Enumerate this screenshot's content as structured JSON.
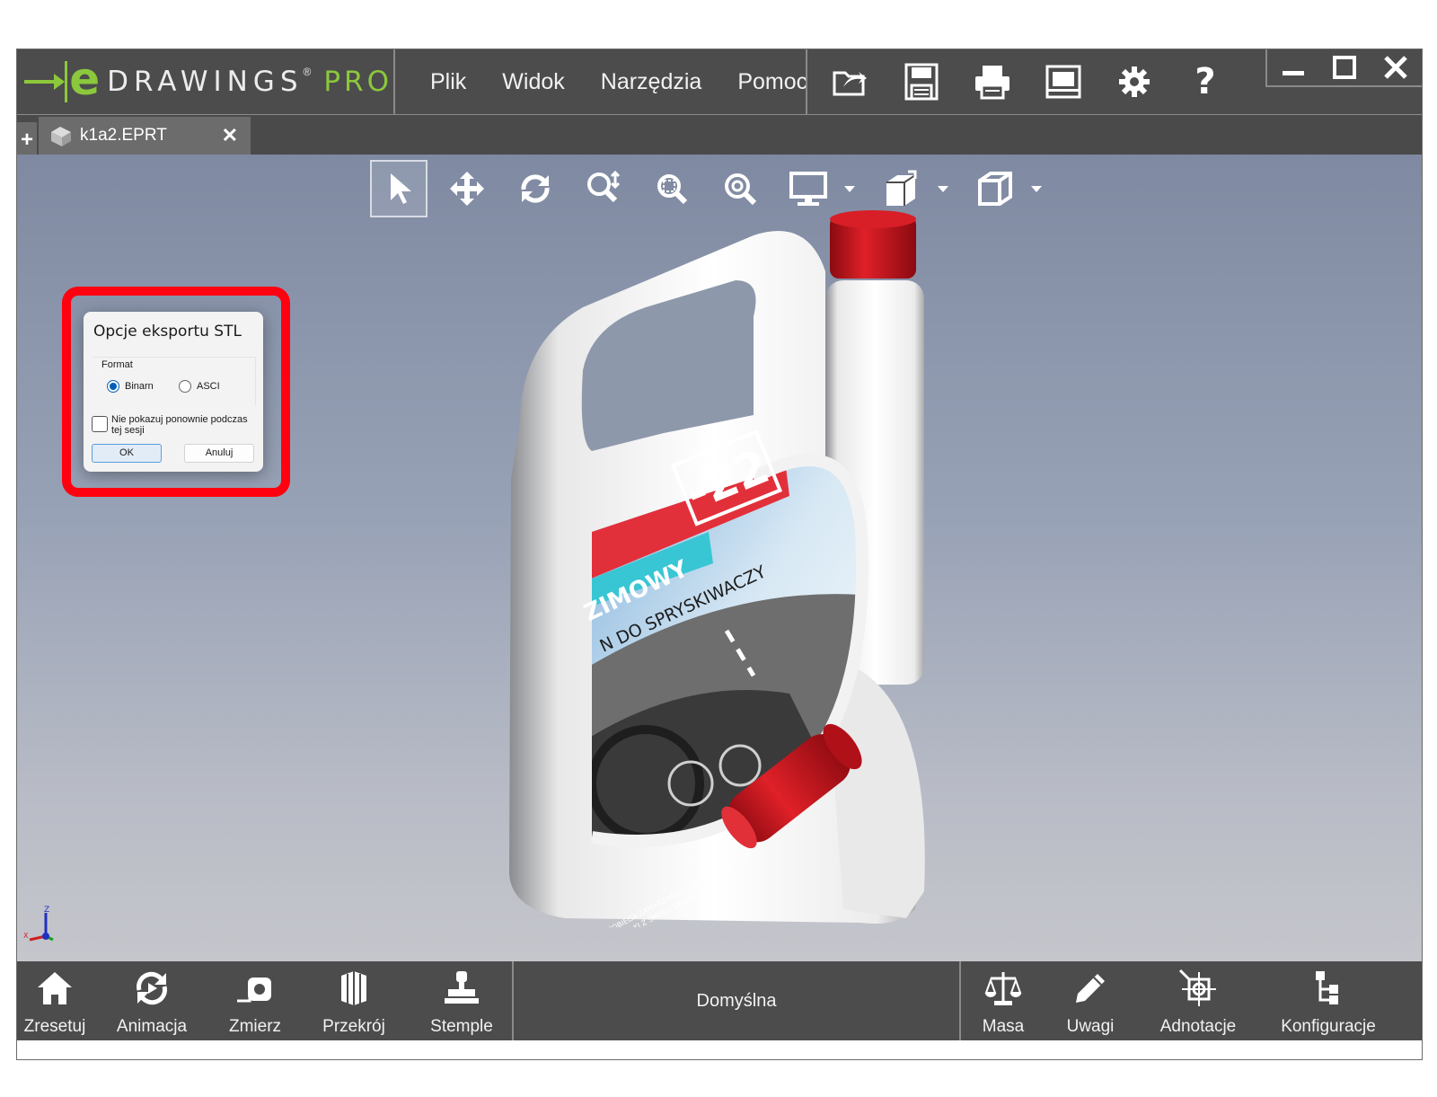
{
  "app": {
    "logo_e": "e",
    "logo_brand": "DRAWINGS",
    "logo_reg": "®",
    "logo_pro": "PRO"
  },
  "menu": [
    {
      "label": "Plik"
    },
    {
      "label": "Widok"
    },
    {
      "label": "Narzędzia"
    },
    {
      "label": "Pomoc"
    }
  ],
  "toolbar_icons": [
    "open-icon",
    "save-icon",
    "print-icon",
    "publish-icon",
    "settings-gear-icon",
    "help-icon"
  ],
  "window_controls": [
    "minimize-icon",
    "maximize-icon",
    "close-icon"
  ],
  "tabs": {
    "new_tab_label": "+",
    "active": {
      "label": "k1a2.EPRT",
      "close_label": "✕"
    }
  },
  "view_toolbar": [
    "select-arrow-icon",
    "pan-icon",
    "rotate-icon",
    "zoom-icon",
    "zoom-to-area-icon",
    "zoom-to-fit-icon",
    "display-style-icon",
    "views-icon",
    "view-orientation-icon"
  ],
  "model_label": {
    "temp": "-22",
    "line1": "ZIMOWY",
    "line2": "N DO SPRYSKIWACZY",
    "small1": "ZAPOBIEGA ZAMARZANIU DYSZ SPRYSKIWACZY",
    "small2": "USZCZELKI Z SMUG I ZACIEKÓW"
  },
  "dialog": {
    "title": "Opcje eksportu STL",
    "format_label": "Format",
    "radio_binary": "Binarn",
    "radio_ascii": "ASCI",
    "selected": "Binarn",
    "checkbox_label": "Nie pokazuj ponownie podczas tej sesji",
    "checkbox_checked": false,
    "ok_label": "OK",
    "cancel_label": "Anuluj"
  },
  "triad": {
    "z": "Z",
    "x": "X"
  },
  "bottom_tools": [
    {
      "label": "Zresetuj",
      "icon": "home-icon"
    },
    {
      "label": "Animacja",
      "icon": "animation-icon"
    },
    {
      "label": "Zmierz",
      "icon": "measure-icon"
    },
    {
      "label": "Przekrój",
      "icon": "section-icon"
    },
    {
      "label": "Stemple",
      "icon": "stamp-icon"
    }
  ],
  "configuration_name": "Domyślna",
  "bottom_tools_right": [
    {
      "label": "Masa",
      "icon": "mass-scale-icon"
    },
    {
      "label": "Uwagi",
      "icon": "markup-pen-icon"
    },
    {
      "label": "Adnotacje",
      "icon": "annotations-icon"
    },
    {
      "label": "Konfiguracje",
      "icon": "configurations-icon"
    }
  ],
  "colors": {
    "accent_green": "#8cc83c",
    "highlight_red": "#ff0010",
    "chrome_gray": "#4c4c4c",
    "cap_red": "#c8141c"
  }
}
